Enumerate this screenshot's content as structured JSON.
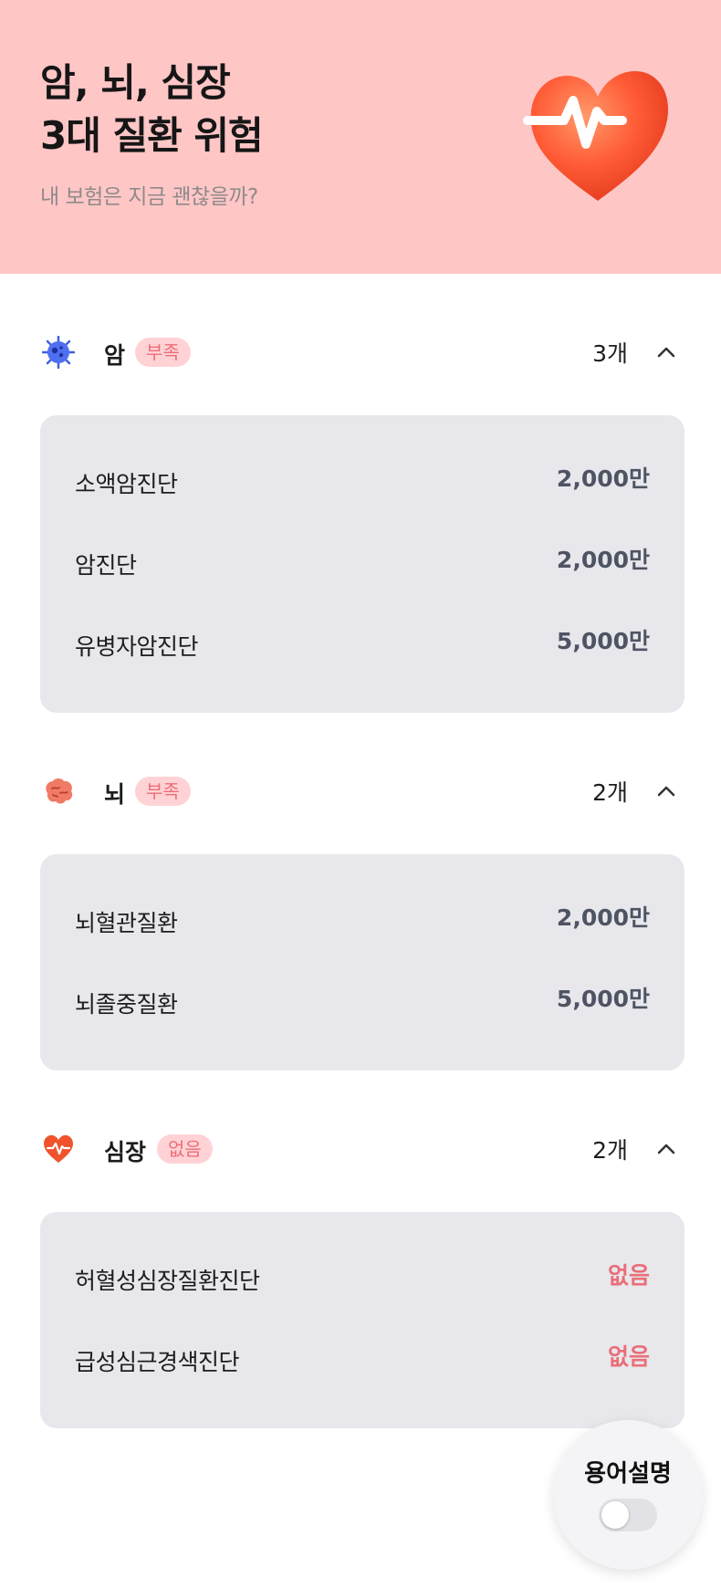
{
  "header": {
    "title": "암, 뇌, 심장\n3대 질환 위험",
    "subtitle": "내 보험은 지금 괜찮을까?",
    "illustration": "heart-pulse-icon"
  },
  "sections": [
    {
      "name": "암",
      "status": "부족",
      "count": "3개",
      "icon": "cancer-cell-icon",
      "items": [
        {
          "label": "소액암진단",
          "value": "2,000만"
        },
        {
          "label": "암진단",
          "value": "2,000만"
        },
        {
          "label": "유병자암진단",
          "value": "5,000만"
        }
      ]
    },
    {
      "name": "뇌",
      "status": "부족",
      "count": "2개",
      "icon": "brain-icon",
      "items": [
        {
          "label": "뇌혈관질환",
          "value": "2,000만"
        },
        {
          "label": "뇌졸중질환",
          "value": "5,000만"
        }
      ]
    },
    {
      "name": "심장",
      "status": "없음",
      "count": "2개",
      "icon": "heart-icon",
      "items": [
        {
          "label": "허혈성심장질환진단",
          "value": "없음"
        },
        {
          "label": "급성심근경색진단",
          "value": "없음"
        }
      ]
    }
  ],
  "glossary": {
    "label": "용어설명",
    "toggle_on": false
  },
  "colors": {
    "banner": "#ffc6c6",
    "badge_bg": "#ffd3d6",
    "badge_text": "#ee6d78",
    "card": "#e8e8ec",
    "value": "#4e5463",
    "none_value": "#ea6e78"
  }
}
